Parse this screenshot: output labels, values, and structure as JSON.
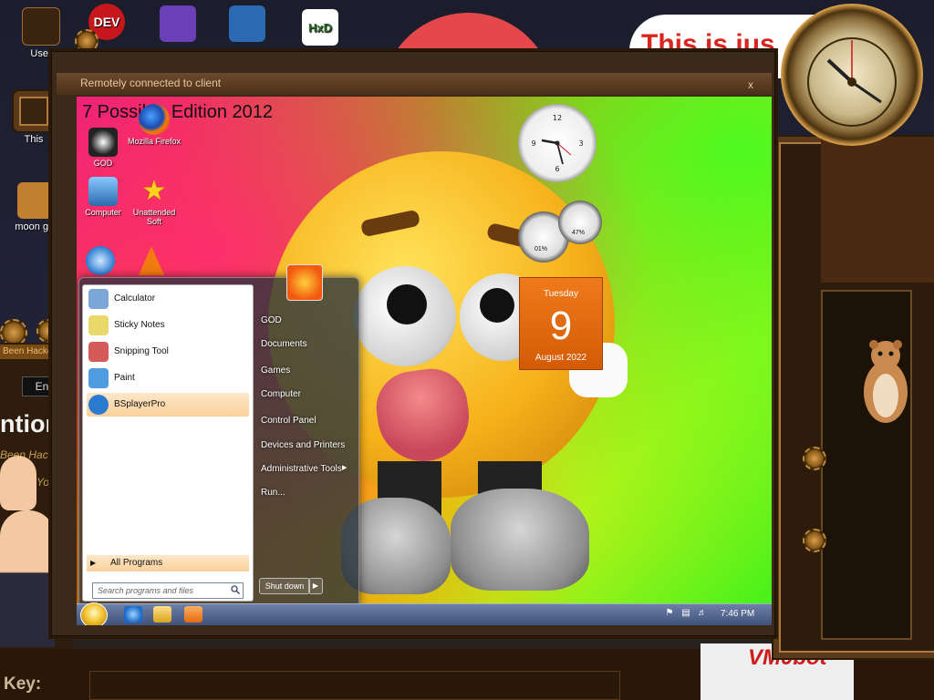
{
  "background_desktop": {
    "icons": [
      {
        "label": "DEV",
        "name": "dev-icon"
      },
      {
        "label": "",
        "name": "visual-studio-icon"
      },
      {
        "label": "",
        "name": "virtualbox-icon"
      },
      {
        "label": "HxD",
        "name": "hxd-icon"
      },
      {
        "label": "User",
        "name": "user-folder-icon"
      },
      {
        "label": "This",
        "name": "this-icon"
      },
      {
        "label": "moon girl",
        "name": "moon-girl-icon"
      }
    ],
    "banner_text": "This is jus",
    "hack_bar_text": "Been Hacked",
    "lang_button": "Engli",
    "attention_text": "ntion!",
    "hacked_line": "Been Hacke",
    "youcan_line": "You Ca",
    "key_label": "Key:",
    "vmobot_text": "VM0bot"
  },
  "remote_window": {
    "title": "Remotely connected to client",
    "close_glyph": "x"
  },
  "remote_desktop": {
    "edition_text": "7 Possible Edition 2012",
    "icons": [
      {
        "label": "GOD",
        "name": "god-icon"
      },
      {
        "label": "Mozilla Firefox",
        "name": "firefox-icon"
      },
      {
        "label": "Computer",
        "name": "computer-icon"
      },
      {
        "label": "Unattended Soft",
        "name": "unattended-soft-icon"
      }
    ],
    "calendar": {
      "day": "Tuesday",
      "date": "9",
      "month_year": "August 2022"
    },
    "meters": {
      "cpu": "01%",
      "ram": "47%"
    }
  },
  "start_menu": {
    "pinned": [
      {
        "label": "Calculator",
        "name": "calculator-icon",
        "color": "#7aa7d8"
      },
      {
        "label": "Sticky Notes",
        "name": "sticky-notes-icon",
        "color": "#e9d86a"
      },
      {
        "label": "Snipping Tool",
        "name": "snipping-tool-icon",
        "color": "#d55b5b"
      },
      {
        "label": "Paint",
        "name": "paint-icon",
        "color": "#4f9de0"
      },
      {
        "label": "BSplayerPro",
        "name": "bsplayer-icon",
        "color": "#2a7ad0"
      }
    ],
    "all_programs": "All Programs",
    "search_placeholder": "Search programs and files",
    "right_items": [
      "GOD",
      "Documents",
      "Games",
      "Computer",
      "Control Panel",
      "Devices and Printers",
      "Administrative Tools",
      "Run..."
    ],
    "shutdown_label": "Shut down"
  },
  "taskbar": {
    "time": "7:46 PM",
    "apps": [
      "internet-explorer-icon",
      "explorer-folder-icon",
      "media-player-icon"
    ]
  }
}
